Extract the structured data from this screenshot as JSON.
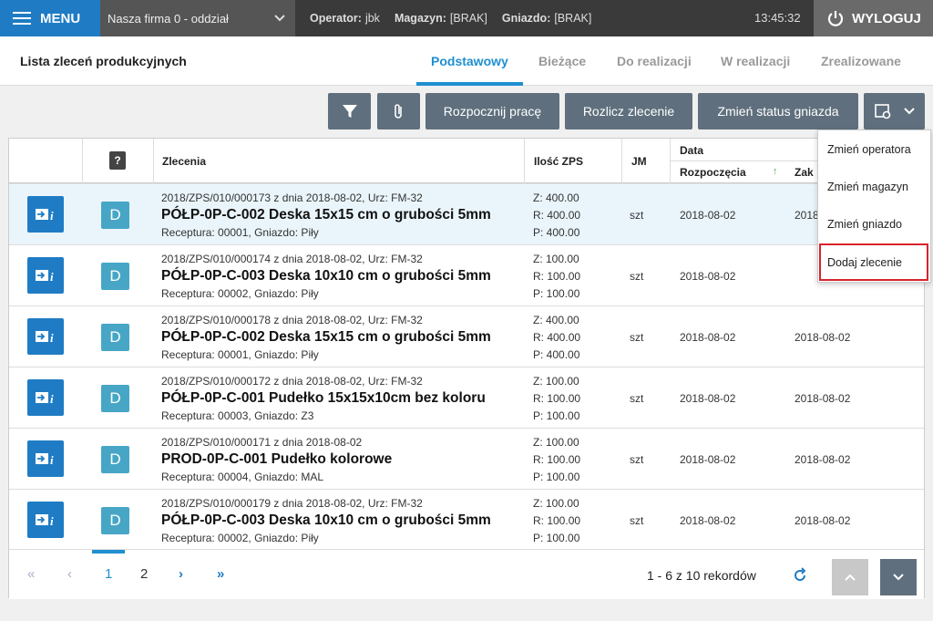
{
  "topbar": {
    "menu_label": "MENU",
    "company": "Nasza firma 0 - oddział",
    "operator_label": "Operator:",
    "operator_value": "jbk",
    "warehouse_label": "Magazyn:",
    "warehouse_value": "[BRAK]",
    "socket_label": "Gniazdo:",
    "socket_value": "[BRAK]",
    "time": "13:45:32",
    "logout_label": "WYLOGUJ"
  },
  "header": {
    "title": "Lista zleceń produkcyjnych",
    "tabs": [
      "Podstawowy",
      "Bieżące",
      "Do realizacji",
      "W realizacji",
      "Zrealizowane"
    ]
  },
  "toolbar": {
    "start_work": "Rozpocznij pracę",
    "settle": "Rozlicz zlecenie",
    "change_status": "Zmień status gniazda"
  },
  "table": {
    "headers": {
      "help": "?",
      "orders": "Zlecenia",
      "qty": "Ilość ZPS",
      "jm": "JM",
      "date": "Data",
      "start": "Rozpoczęcia",
      "end": "Zak"
    },
    "rows": [
      {
        "ref": "2018/ZPS/010/000173 z dnia 2018-08-02, Urz: FM-32",
        "name": "PÓŁP-0P-C-002 Deska 15x15 cm o grubości 5mm",
        "info": "Receptura: 00001, Gniazdo: Piły",
        "z": "Z: 400.00",
        "r": "R: 400.00",
        "p": "P: 400.00",
        "jm": "szt",
        "start": "2018-08-02",
        "end": "2018",
        "badge": "D"
      },
      {
        "ref": "2018/ZPS/010/000174 z dnia 2018-08-02, Urz: FM-32",
        "name": "PÓŁP-0P-C-003 Deska 10x10 cm o grubości 5mm",
        "info": "Receptura: 00002, Gniazdo: Piły",
        "z": "Z: 100.00",
        "r": "R: 100.00",
        "p": "P: 100.00",
        "jm": "szt",
        "start": "2018-08-02",
        "end": "",
        "badge": "D"
      },
      {
        "ref": "2018/ZPS/010/000178 z dnia 2018-08-02, Urz: FM-32",
        "name": "PÓŁP-0P-C-002 Deska 15x15 cm o grubości 5mm",
        "info": "Receptura: 00001, Gniazdo: Piły",
        "z": "Z: 400.00",
        "r": "R: 400.00",
        "p": "P: 400.00",
        "jm": "szt",
        "start": "2018-08-02",
        "end": "2018-08-02",
        "badge": "D"
      },
      {
        "ref": "2018/ZPS/010/000172 z dnia 2018-08-02, Urz: FM-32",
        "name": "PÓŁP-0P-C-001 Pudełko 15x15x10cm bez koloru",
        "info": "Receptura: 00003, Gniazdo: Z3",
        "z": "Z: 100.00",
        "r": "R: 100.00",
        "p": "P: 100.00",
        "jm": "szt",
        "start": "2018-08-02",
        "end": "2018-08-02",
        "badge": "D"
      },
      {
        "ref": "2018/ZPS/010/000171 z dnia 2018-08-02",
        "name": "PROD-0P-C-001 Pudełko kolorowe",
        "info": "Receptura: 00004, Gniazdo: MAL",
        "z": "Z: 100.00",
        "r": "R: 100.00",
        "p": "P: 100.00",
        "jm": "szt",
        "start": "2018-08-02",
        "end": "2018-08-02",
        "badge": "D"
      },
      {
        "ref": "2018/ZPS/010/000179 z dnia 2018-08-02, Urz: FM-32",
        "name": "PÓŁP-0P-C-003 Deska 10x10 cm o grubości 5mm",
        "info": "Receptura: 00002, Gniazdo: Piły",
        "z": "Z: 100.00",
        "r": "R: 100.00",
        "p": "P: 100.00",
        "jm": "szt",
        "start": "2018-08-02",
        "end": "2018-08-02",
        "badge": "D"
      }
    ]
  },
  "pagination": {
    "first": "«",
    "prev": "‹",
    "page1": "1",
    "page2": "2",
    "next": "›",
    "last": "»",
    "summary": "1 - 6 z 10 rekordów"
  },
  "dropdown": {
    "items": [
      "Zmień operatora",
      "Zmień magazyn",
      "Zmień gniazdo",
      "Dodaj zlecenie"
    ]
  },
  "colors": {
    "accent": "#1f8fd0",
    "highlight": "#d8232a",
    "toolbar_btn": "#5f6f7d"
  }
}
